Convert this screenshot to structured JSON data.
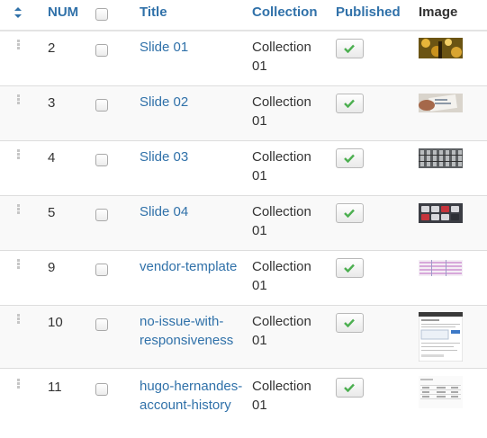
{
  "table": {
    "headers": {
      "num": "NUM",
      "title": "Title",
      "collection": "Collection",
      "published": "Published",
      "image": "Image"
    },
    "rows": [
      {
        "num": "2",
        "title": "Slide 01",
        "collection": "Collection 01",
        "published": true,
        "image": "golden-bokeh-thumbnail"
      },
      {
        "num": "3",
        "title": "Slide 02",
        "collection": "Collection 01",
        "published": true,
        "image": "hand-document-thumbnail"
      },
      {
        "num": "4",
        "title": "Slide 03",
        "collection": "Collection 01",
        "published": true,
        "image": "building-facade-thumbnail"
      },
      {
        "num": "5",
        "title": "Slide 04",
        "collection": "Collection 01",
        "published": true,
        "image": "calculator-thumbnail"
      },
      {
        "num": "9",
        "title": "vendor-template",
        "collection": "Collection 01",
        "published": true,
        "image": "spreadsheet-thumbnail"
      },
      {
        "num": "10",
        "title": "no-issue-with-responsiveness",
        "collection": "Collection 01",
        "published": true,
        "image": "webpage-screenshot-thumbnail"
      },
      {
        "num": "11",
        "title": "hugo-hernandes-account-history",
        "collection": "Collection 01",
        "published": true,
        "image": "account-table-thumbnail"
      }
    ]
  },
  "icons": {
    "sort": "sort-icon",
    "drag": "drag-handle-icon",
    "published": "checkmark-icon"
  },
  "colors": {
    "link": "#3071a9",
    "check": "#4caf50",
    "row_alt": "#f9f9f9"
  }
}
